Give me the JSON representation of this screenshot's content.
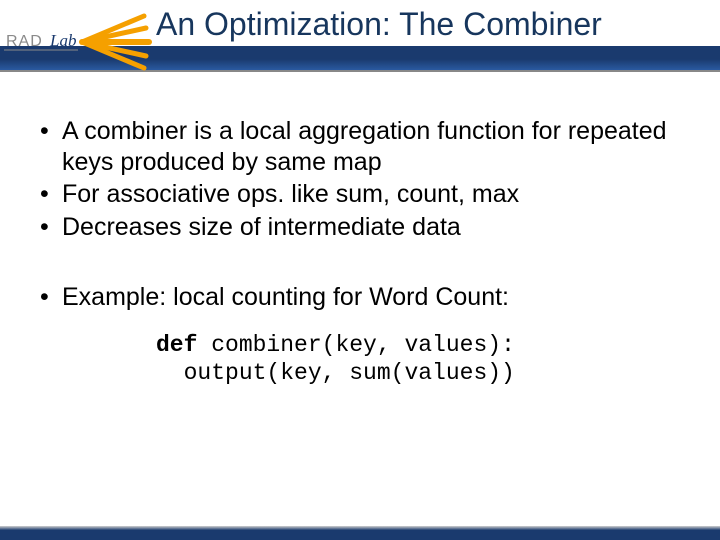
{
  "header": {
    "title": "An Optimization: The Combiner",
    "logo_text_primary": "RAD",
    "logo_text_secondary": "Lab"
  },
  "bullets": [
    "A combiner is a local aggregation function for repeated keys produced by same map",
    "For associative ops. like sum, count, max",
    "Decreases size of intermediate data",
    "Example: local counting for Word Count:"
  ],
  "code": {
    "keyword": "def",
    "line1_rest": " combiner(key, values):",
    "line2": "  output(key, sum(values))"
  }
}
